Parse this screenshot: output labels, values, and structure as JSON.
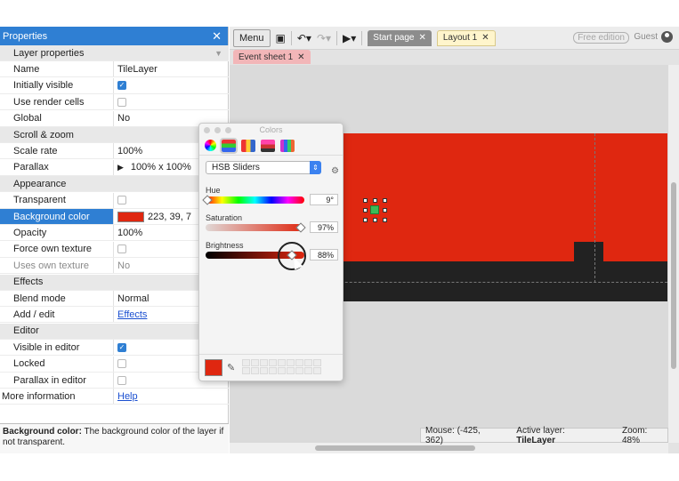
{
  "properties": {
    "title": "Properties",
    "rows": [
      {
        "type": "section",
        "label": "Layer properties"
      },
      {
        "type": "prop",
        "label": "Name",
        "value": "TileLayer"
      },
      {
        "type": "check",
        "label": "Initially visible",
        "checked": true
      },
      {
        "type": "check",
        "label": "Use render cells",
        "checked": false
      },
      {
        "type": "prop",
        "label": "Global",
        "value": "No"
      },
      {
        "type": "section",
        "label": "Scroll & zoom"
      },
      {
        "type": "prop",
        "label": "Scale rate",
        "value": "100%"
      },
      {
        "type": "prop",
        "label": "Parallax",
        "value": "100% x 100%"
      },
      {
        "type": "section",
        "label": "Appearance"
      },
      {
        "type": "check",
        "label": "Transparent",
        "checked": false
      },
      {
        "type": "color",
        "label": "Background color",
        "value": "223, 39, 7"
      },
      {
        "type": "prop",
        "label": "Opacity",
        "value": "100%"
      },
      {
        "type": "check",
        "label": "Force own texture",
        "checked": false
      },
      {
        "type": "prop",
        "label": "Uses own texture",
        "value": "No"
      },
      {
        "type": "section",
        "label": "Effects"
      },
      {
        "type": "prop",
        "label": "Blend mode",
        "value": "Normal"
      },
      {
        "type": "link",
        "label": "Add / edit",
        "value": "Effects"
      },
      {
        "type": "section",
        "label": "Editor"
      },
      {
        "type": "check",
        "label": "Visible in editor",
        "checked": true
      },
      {
        "type": "check",
        "label": "Locked",
        "checked": false
      },
      {
        "type": "check",
        "label": "Parallax in editor",
        "checked": false
      },
      {
        "type": "link",
        "label": "More information",
        "value": "Help"
      }
    ],
    "help_title": "Background color:",
    "help_text": "The background color of the layer if not transparent."
  },
  "toolbar": {
    "menu_label": "Menu",
    "tabs": [
      {
        "label": "Start page"
      },
      {
        "label": "Layout 1"
      }
    ],
    "sub_tab": "Event sheet 1",
    "free_edition": "Free edition",
    "user": "Guest"
  },
  "status": {
    "mouse": "Mouse: (-425, 362)",
    "active_layer_label": "Active layer:",
    "active_layer": "TileLayer",
    "zoom": "Zoom: 48%"
  },
  "colors_panel": {
    "title": "Colors",
    "mode": "HSB Sliders",
    "hue_label": "Hue",
    "hue_value": "9°",
    "saturation_label": "Saturation",
    "saturation_value": "97%",
    "brightness_label": "Brightness",
    "brightness_value": "88%",
    "hue_fraction": 0.025,
    "saturation_fraction": 0.97,
    "brightness_fraction": 0.88,
    "current_color": "#df2710"
  },
  "colors": {
    "accent": "#2f7fd3",
    "layer_background": "#df2710"
  }
}
